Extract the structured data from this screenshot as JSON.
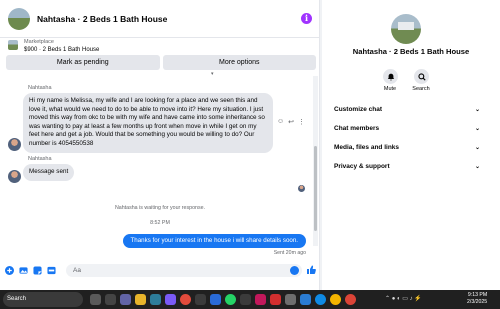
{
  "header": {
    "title": "Nahtasha · 2 Beds 1 Bath House",
    "info_icon": "info-icon"
  },
  "listing": {
    "source": "Marketplace",
    "title": "$900 · 2 Beds 1 Bath House"
  },
  "actions": {
    "mark_pending": "Mark as pending",
    "more_options": "More options"
  },
  "messages": {
    "sender1": "Nahtasha",
    "msg1": "Hi my name is Melissa, my wife and I are looking for a place and we seen this and love it, what would we need to do to be able to move into it? Here my situation. I just moved this way from okc to be with my wife and have came into some inheritance so was wanting to pay at least a few months up front when move in while I get on my feet here and get a job. Would that be something you would be willing to do? Our number is 4054550538",
    "sender2": "Nahtasha",
    "msg2": "Message sent",
    "waiting": "Nahtasha is waiting for your response.",
    "time": "8:52 PM",
    "outgoing": "Thanks for your interest in the house i will share details soon.",
    "sent_status": "Sent 20m ago"
  },
  "composer": {
    "placeholder": "Aa"
  },
  "profile": {
    "name": "Nahtasha · 2 Beds 1 Bath House",
    "mute": "Mute",
    "search": "Search",
    "sections": [
      "Customize chat",
      "Chat members",
      "Media, files and links",
      "Privacy & support"
    ]
  },
  "taskbar": {
    "search": "Search",
    "time": "9:13 PM",
    "date": "2/3/2025"
  },
  "colors": {
    "accent": "#1877f2",
    "bubble_in": "#e4e6eb",
    "info": "#a033ff"
  }
}
